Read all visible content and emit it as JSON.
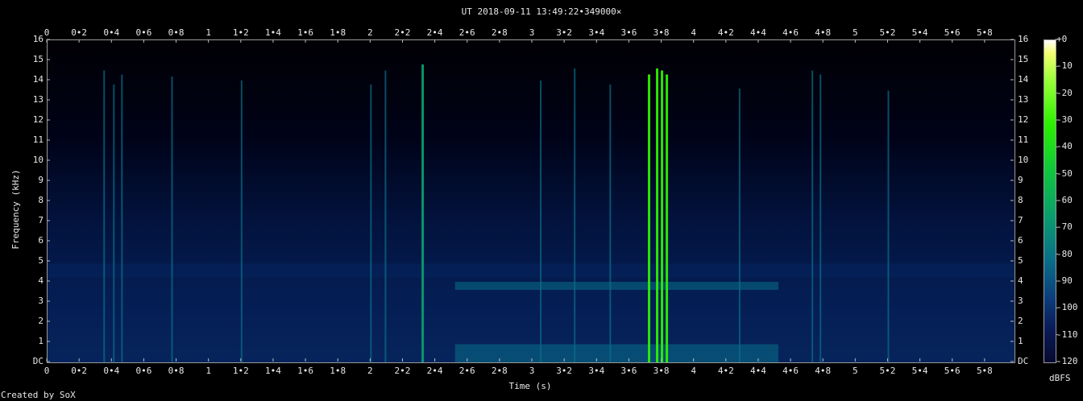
{
  "chart_data": {
    "type": "heatmap",
    "title": "UT 2018-09-11 13:49:22•349000×",
    "xlabel": "Time (s)",
    "ylabel": "Frequency (kHz)",
    "xlim": [
      0,
      5.98
    ],
    "ylim": [
      0,
      16
    ],
    "x_ticks": [
      "0",
      "0•2",
      "0•4",
      "0•6",
      "0•8",
      "1",
      "1•2",
      "1•4",
      "1•6",
      "1•8",
      "2",
      "2•2",
      "2•4",
      "2•6",
      "2•8",
      "3",
      "3•2",
      "3•4",
      "3•6",
      "3•8",
      "4",
      "4•2",
      "4•4",
      "4•6",
      "4•8",
      "5",
      "5•2",
      "5•4",
      "5•6",
      "5•8"
    ],
    "y_ticks": [
      "DC",
      "1",
      "2",
      "3",
      "4",
      "5",
      "6",
      "7",
      "8",
      "9",
      "10",
      "11",
      "12",
      "13",
      "14",
      "15",
      "16"
    ],
    "colorbar": {
      "label": "dBFS",
      "range": [
        -120,
        0
      ],
      "ticks": [
        "+0",
        "-10",
        "-20",
        "-30",
        "-40",
        "-50",
        "-60",
        "-70",
        "-80",
        "-90",
        "-100",
        "-110",
        "-120"
      ]
    },
    "colormap_stops": [
      "#000004",
      "#06245c",
      "#0a6f88",
      "#0a9c6e",
      "#2cf000",
      "#f4ff70",
      "#ffffff"
    ],
    "vertical_events": [
      {
        "t": 0.35,
        "fmax": 14.5,
        "dbfs": -75
      },
      {
        "t": 0.41,
        "fmax": 13.8,
        "dbfs": -82
      },
      {
        "t": 0.46,
        "fmax": 14.3,
        "dbfs": -85
      },
      {
        "t": 0.77,
        "fmax": 14.2,
        "dbfs": -75
      },
      {
        "t": 1.2,
        "fmax": 14.0,
        "dbfs": -85
      },
      {
        "t": 2.0,
        "fmax": 13.8,
        "dbfs": -85
      },
      {
        "t": 2.09,
        "fmax": 14.5,
        "dbfs": -80
      },
      {
        "t": 2.32,
        "fmax": 14.8,
        "dbfs": -55
      },
      {
        "t": 3.05,
        "fmax": 14.0,
        "dbfs": -85
      },
      {
        "t": 3.26,
        "fmax": 14.6,
        "dbfs": -80
      },
      {
        "t": 3.48,
        "fmax": 13.8,
        "dbfs": -85
      },
      {
        "t": 3.72,
        "fmax": 14.3,
        "dbfs": -40
      },
      {
        "t": 3.77,
        "fmax": 14.6,
        "dbfs": -40
      },
      {
        "t": 3.8,
        "fmax": 14.5,
        "dbfs": -45
      },
      {
        "t": 3.83,
        "fmax": 14.3,
        "dbfs": -45
      },
      {
        "t": 4.28,
        "fmax": 13.6,
        "dbfs": -85
      },
      {
        "t": 4.73,
        "fmax": 14.5,
        "dbfs": -80
      },
      {
        "t": 4.78,
        "fmax": 14.3,
        "dbfs": -80
      },
      {
        "t": 5.2,
        "fmax": 13.5,
        "dbfs": -85
      }
    ],
    "horizontal_bands": [
      {
        "fmin": 3.6,
        "fmax": 4.0,
        "tmin": 2.52,
        "tmax": 4.52,
        "dbfs": -88
      },
      {
        "fmin": 0.0,
        "fmax": 0.9,
        "tmin": 2.52,
        "tmax": 4.52,
        "dbfs": -78
      },
      {
        "fmin": 4.2,
        "fmax": 4.9,
        "tmin": 0,
        "tmax": 5.98,
        "dbfs": -95
      }
    ],
    "annotation": "Created by SoX"
  }
}
